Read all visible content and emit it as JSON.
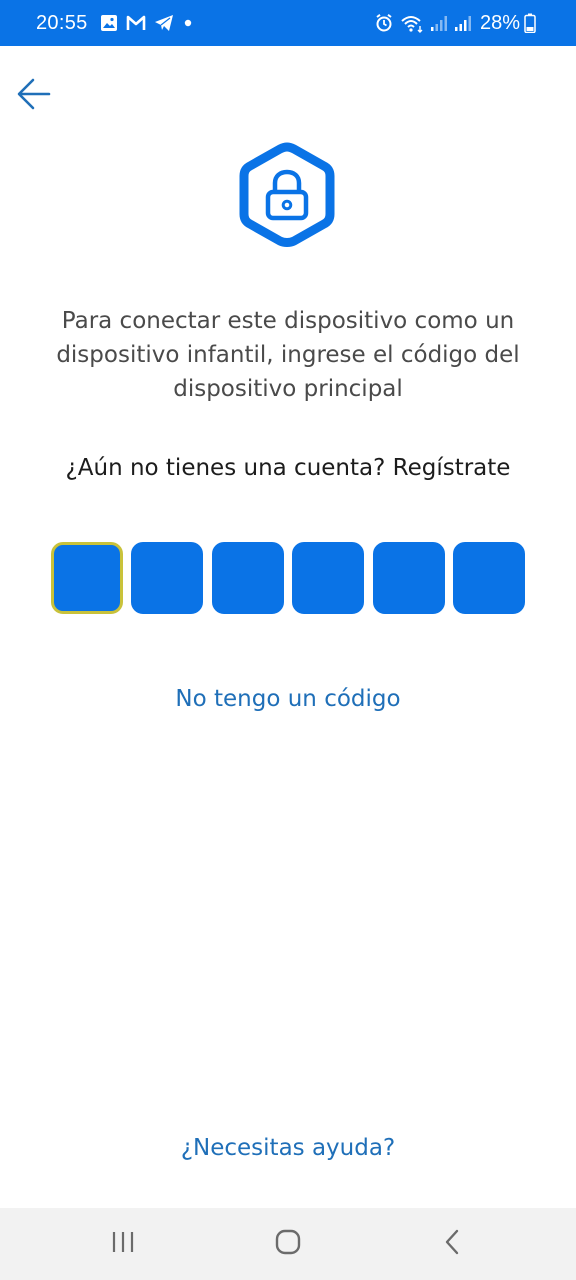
{
  "status_bar": {
    "time": "20:55",
    "battery_percent": "28%",
    "left_icons": [
      "gallery-icon",
      "gmail-icon",
      "telegram-icon",
      "notification-dot-icon"
    ],
    "right_icons": [
      "alarm-icon",
      "wifi-icon",
      "signal-icon",
      "signal-icon",
      "battery-icon"
    ],
    "background": "#0a73e6"
  },
  "header": {
    "back_icon": "arrow-left-icon"
  },
  "lock_badge": {
    "icon": "padlock-icon",
    "color": "#0a73e6"
  },
  "main": {
    "description": "Para conectar este dispositivo como un dispositivo infantil, ingrese el código del dispositivo principal",
    "signup_prompt": "¿Aún no tienes una cuenta? Regístrate",
    "code_boxes": [
      "",
      "",
      "",
      "",
      "",
      ""
    ],
    "focused_box_index": 0,
    "no_code_link": "No tengo un código"
  },
  "footer": {
    "help_link": "¿Necesitas ayuda?"
  },
  "nav_bar": {
    "buttons": [
      "recent-apps-icon",
      "home-icon",
      "back-icon"
    ]
  },
  "colors": {
    "accent": "#0a73e6",
    "link": "#1f6fb8",
    "focus_border": "#c9c23a"
  }
}
